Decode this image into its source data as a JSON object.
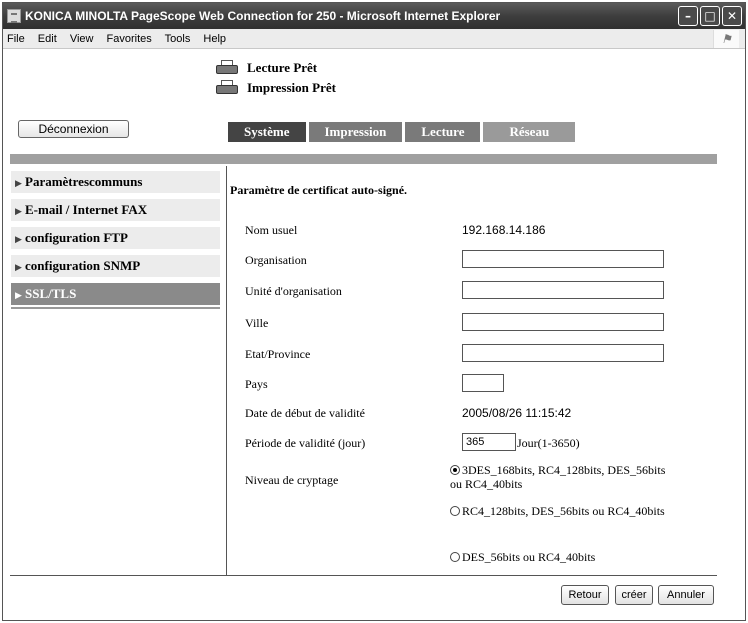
{
  "window": {
    "title": "KONICA MINOLTA PageScope Web Connection for 250 - Microsoft Internet Explorer"
  },
  "menu": [
    "File",
    "Edit",
    "View",
    "Favorites",
    "Tools",
    "Help"
  ],
  "status": {
    "scan": "Lecture Prêt",
    "print": "Impression Prêt"
  },
  "logout_label": "Déconnexion",
  "tabs": [
    "Système",
    "Impression",
    "Lecture",
    "Réseau"
  ],
  "active_tab": "Système",
  "sidebar": {
    "items": [
      {
        "label": "Paramètrescommuns"
      },
      {
        "label": "E-mail / Internet FAX"
      },
      {
        "label": "configuration FTP"
      },
      {
        "label": "configuration SNMP"
      },
      {
        "label": "SSL/TLS",
        "selected": true
      }
    ]
  },
  "form": {
    "title": "Paramètre de certificat auto-signé.",
    "common_name": {
      "label": "Nom usuel",
      "value": "192.168.14.186"
    },
    "organization": {
      "label": "Organisation",
      "value": ""
    },
    "org_unit": {
      "label": "Unité d'organisation",
      "value": ""
    },
    "city": {
      "label": "Ville",
      "value": ""
    },
    "state": {
      "label": "Etat/Province",
      "value": ""
    },
    "country": {
      "label": "Pays",
      "value": ""
    },
    "start_date": {
      "label": "Date de début de validité",
      "value": "2005/08/26 11:15:42"
    },
    "validity": {
      "label": "Période de validité (jour)",
      "value": "365",
      "unit": "Jour(1-3650)"
    },
    "encryption": {
      "label": "Niveau de cryptage",
      "options": [
        {
          "label": "3DES_168bits, RC4_128bits, DES_56bits ou RC4_40bits",
          "selected": true
        },
        {
          "label": "RC4_128bits, DES_56bits ou RC4_40bits",
          "selected": false
        },
        {
          "label": "DES_56bits ou RC4_40bits",
          "selected": false
        }
      ]
    }
  },
  "buttons": {
    "back": "Retour",
    "create": "créer",
    "cancel": "Annuler"
  }
}
